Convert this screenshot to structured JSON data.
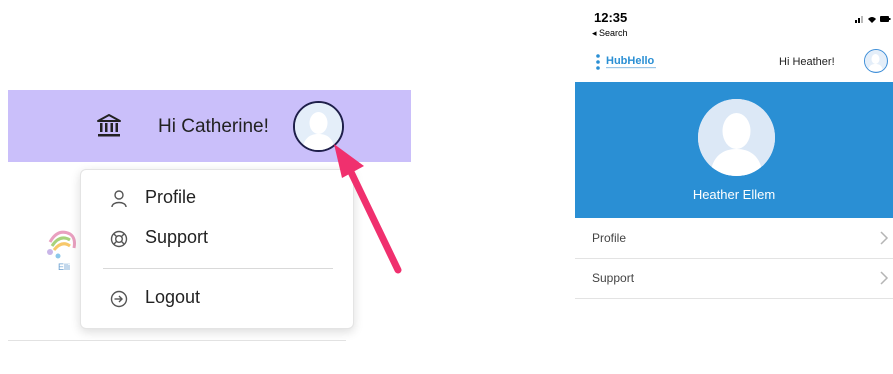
{
  "web": {
    "greeting": "Hi Catherine!",
    "menu": [
      {
        "label": "Profile",
        "icon": "user-icon"
      },
      {
        "label": "Support",
        "icon": "lifebuoy-icon"
      },
      {
        "label": "Logout",
        "icon": "logout-icon"
      }
    ],
    "logo_fragment": "Elli"
  },
  "mobile": {
    "status_time": "12:35",
    "status_back": "◂ Search",
    "app_logo": "HubHello",
    "greeting": "Hi Heather!",
    "profile_name": "Heather Ellem",
    "menu": [
      {
        "label": "Profile"
      },
      {
        "label": "Support"
      }
    ]
  },
  "colors": {
    "web_header_bg": "#cabffa",
    "pink_arrow": "#f0306e",
    "mobile_banner_bg": "#2a8fd4",
    "orange_arrow": "#f6921e"
  }
}
